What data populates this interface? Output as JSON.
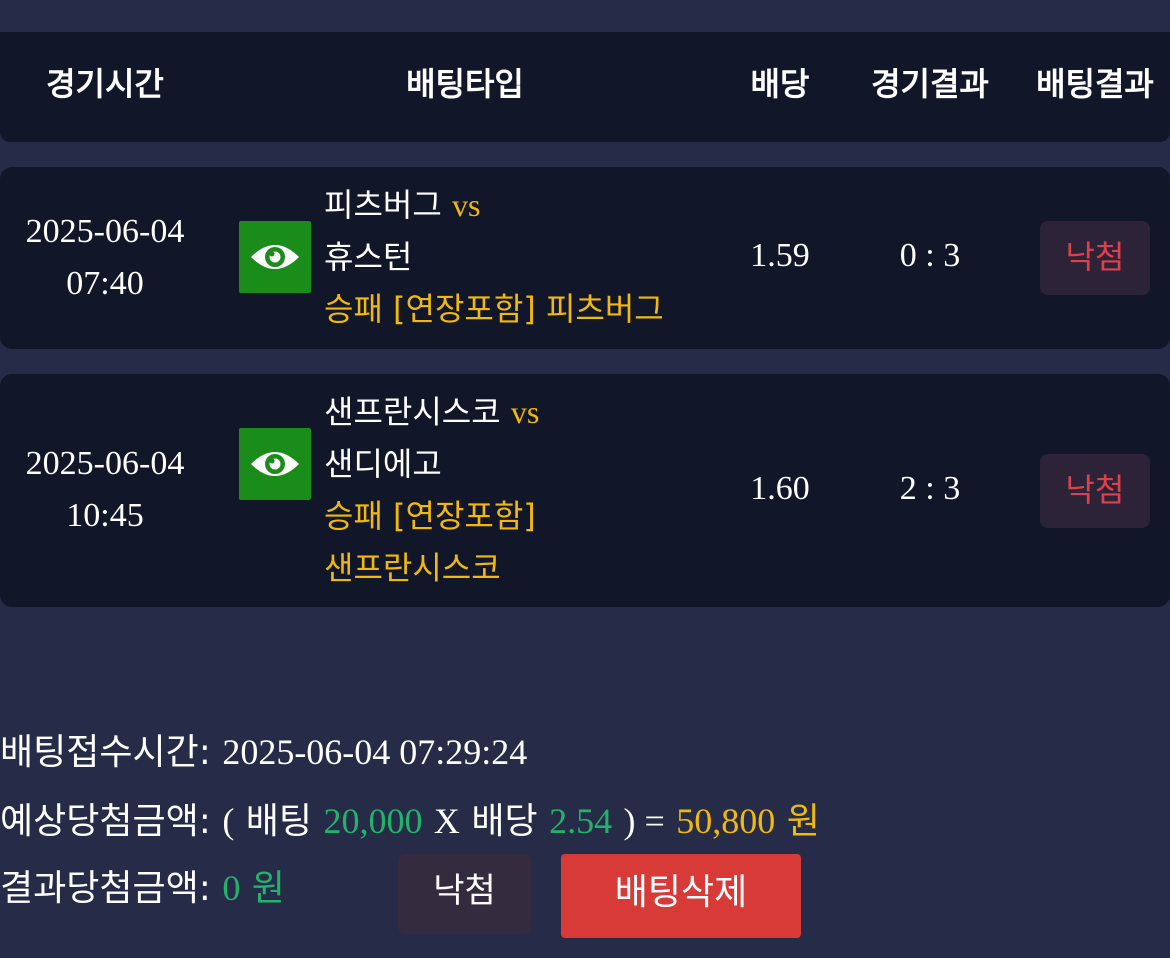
{
  "header": {
    "col_time": "경기시간",
    "col_bet_type": "배팅타입",
    "col_odds": "배당",
    "col_match_result": "경기결과",
    "col_bet_result": "배팅결과"
  },
  "bets": [
    {
      "date": "2025-06-04",
      "time": "07:40",
      "home": "피츠버그",
      "vs": "vs",
      "away": "휴스턴",
      "pick_market": "승패 [연장포함]",
      "pick_team": "피츠버그",
      "odds": "1.59",
      "score": "0 : 3",
      "result": "낙첨"
    },
    {
      "date": "2025-06-04",
      "time": "10:45",
      "home": "샌프란시스코",
      "vs": "vs",
      "away": "샌디에고",
      "pick_market": "승패 [연장포함]",
      "pick_team": "샌프란시스코",
      "odds": "1.60",
      "score": "2 : 3",
      "result": "낙첨"
    }
  ],
  "summary": {
    "bet_time_label": "배팅접수시간",
    "bet_time_value": "2025-06-04 07:29:24",
    "expected_label": "예상당첨금액",
    "open_paren": "(",
    "bet_word": "배팅",
    "bet_amount": "20,000",
    "times": "X",
    "odds_word": "배당",
    "total_odds": "2.54",
    "close_eq": ") =",
    "expected_amount": "50,800",
    "won": "원",
    "result_label": "결과당첨금액",
    "result_amount": "0"
  },
  "actions": {
    "status_label": "낙첨",
    "delete_label": "배팅삭제"
  },
  "colors": {
    "background": "#262c47",
    "panel": "#121629",
    "gold": "#f0b90b",
    "green": "#22b36b",
    "lost_red": "#e0404a",
    "delete_button": "#d83a38",
    "eye_button": "#1a8c1a"
  },
  "icons": {
    "view": "eye-icon"
  }
}
